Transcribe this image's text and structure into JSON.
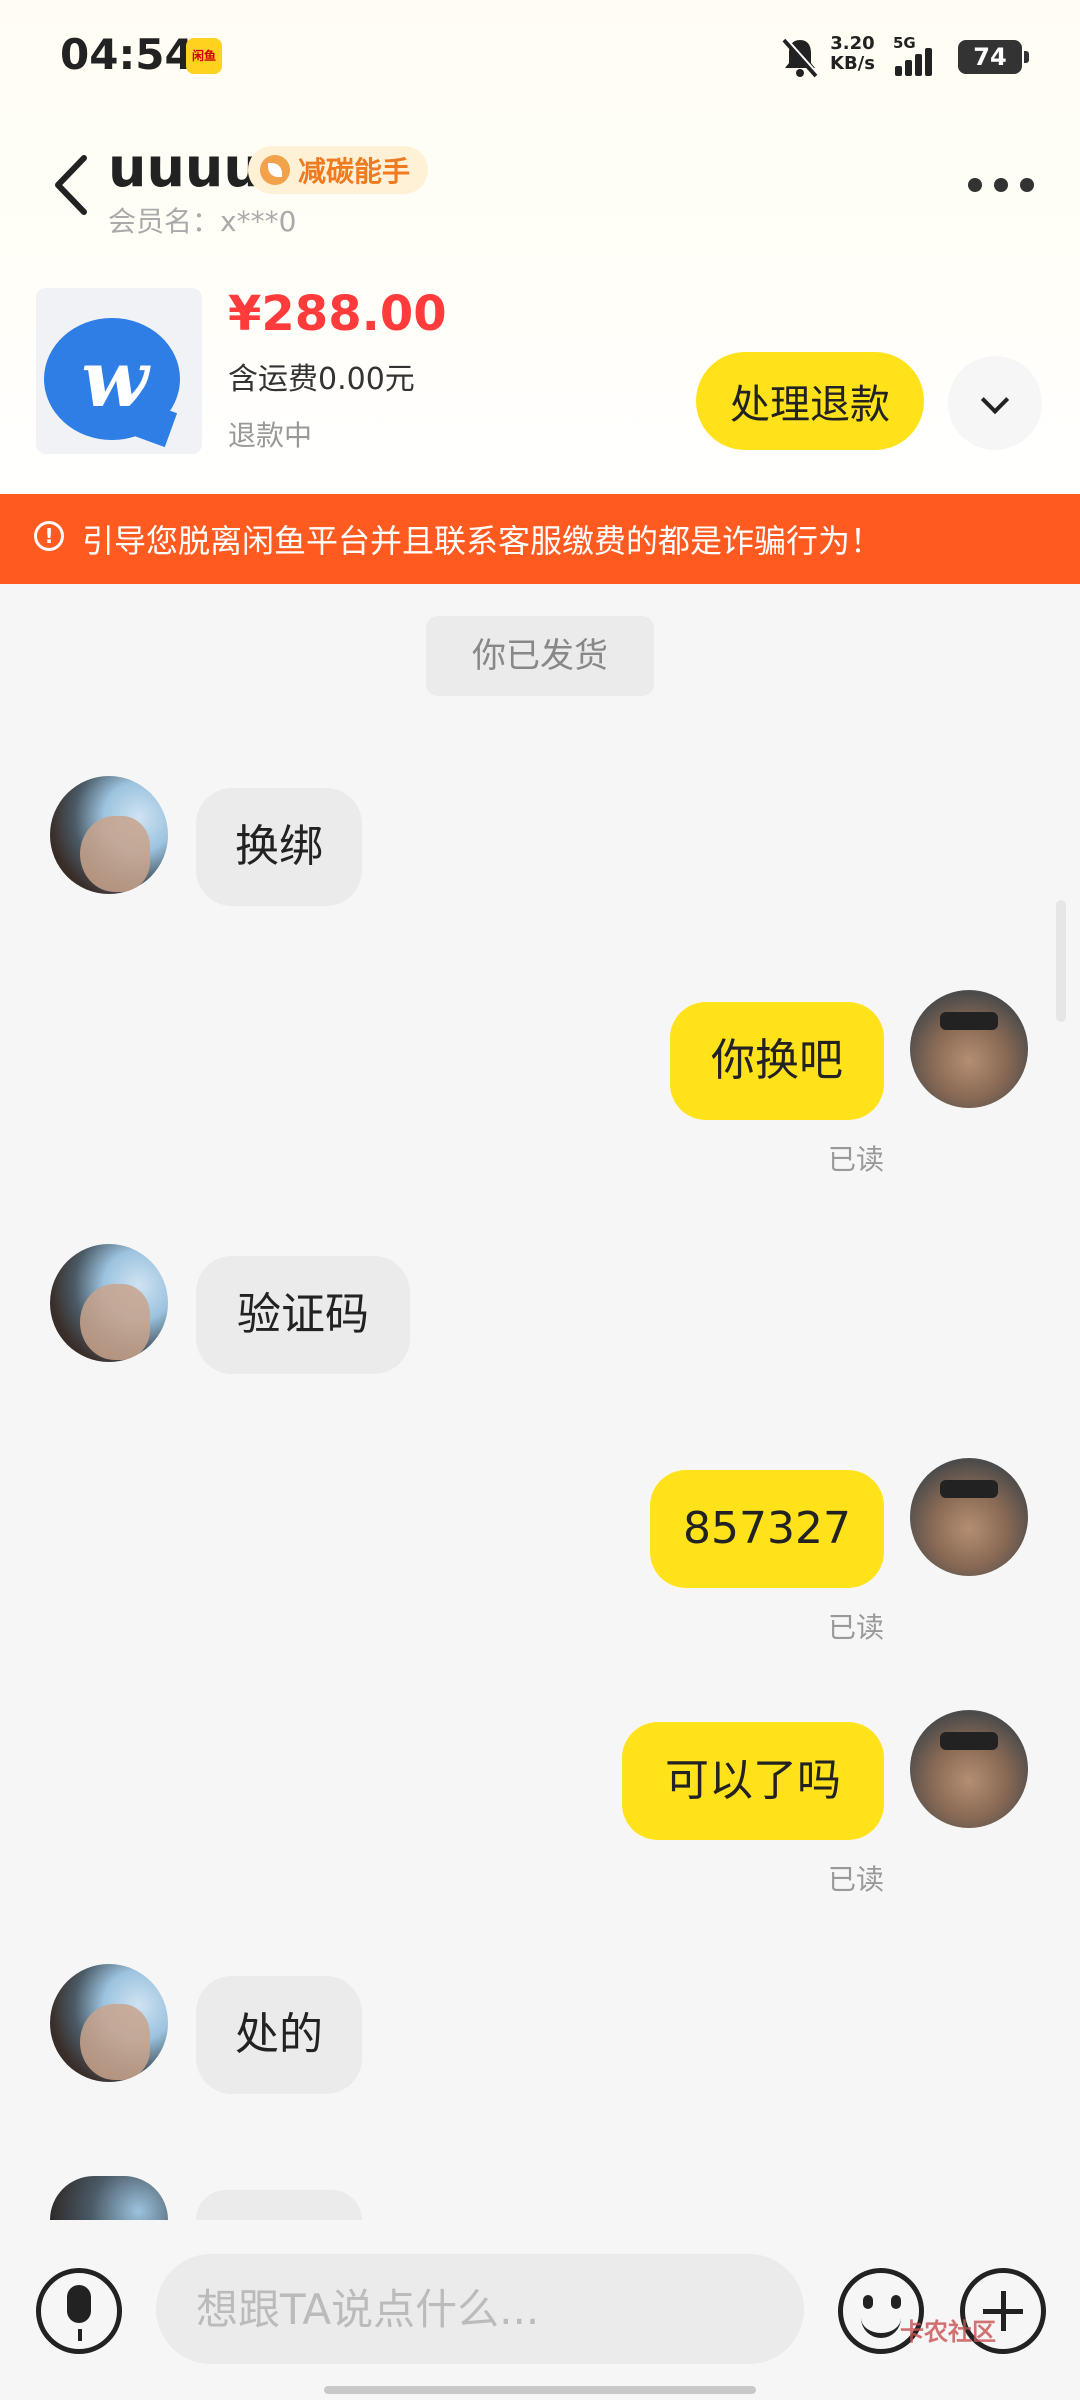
{
  "status_bar": {
    "time": "04:54",
    "app_badge": "闲鱼",
    "net_speed_value": "3.20",
    "net_speed_unit": "KB/s",
    "network": "5G",
    "battery": "74"
  },
  "header": {
    "username": "uuuu",
    "badge": "减碳能手",
    "member_name": "会员名：x***0"
  },
  "product": {
    "price": "¥288.00",
    "shipping": "含运费0.00元",
    "status": "退款中",
    "action_label": "处理退款"
  },
  "warning": {
    "text": "引导您脱离闲鱼平台并且联系客服缴费的都是诈骗行为！"
  },
  "chat": {
    "system_message": "你已发货",
    "messages": [
      {
        "from": "other",
        "text": "换绑"
      },
      {
        "from": "me",
        "text": "你换吧",
        "status": "已读"
      },
      {
        "from": "other",
        "text": "验证码"
      },
      {
        "from": "me",
        "text": "857327",
        "status": "已读"
      },
      {
        "from": "me",
        "text": "可以了吗",
        "status": "已读"
      },
      {
        "from": "other",
        "text": "处的"
      }
    ]
  },
  "input": {
    "placeholder": "想跟TA说点什么..."
  },
  "watermark": "卡农社区",
  "colors": {
    "accent_yellow": "#ffe21a",
    "warning_orange": "#ff5a1f",
    "price_red": "#ff3b3b"
  }
}
